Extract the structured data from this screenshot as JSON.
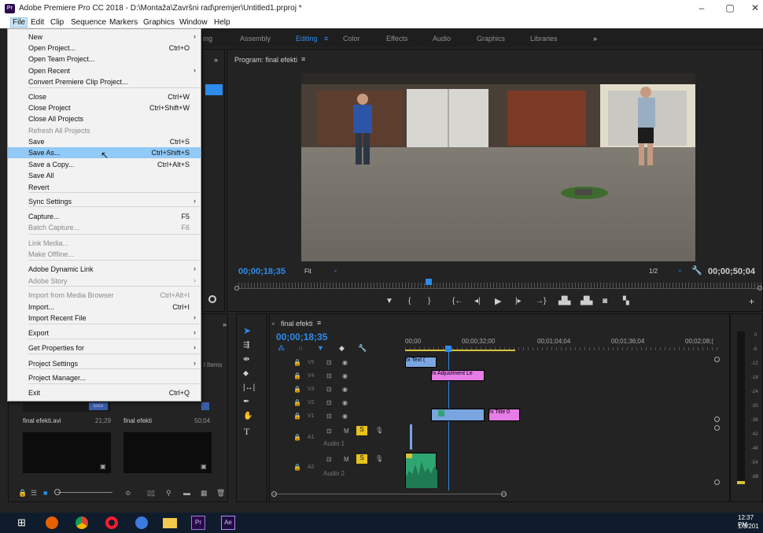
{
  "window": {
    "title": "Adobe Premiere Pro CC 2018 - D:\\Montaža\\Završni rad\\premjer\\Untitled1.prproj *",
    "logo": "Pr",
    "minimize": "–",
    "maximize": "▢",
    "close": "✕"
  },
  "menubar": [
    "File",
    "Edit",
    "Clip",
    "Sequence",
    "Markers",
    "Graphics",
    "Window",
    "Help"
  ],
  "workspaces": [
    "ing",
    "Assembly",
    "Editing",
    "≡",
    "Color",
    "Effects",
    "Audio",
    "Graphics",
    "Libraries",
    "»"
  ],
  "file_menu": [
    {
      "label": "New",
      "shortcut": "",
      "submenu": true,
      "disabled": false
    },
    {
      "label": "Open Project...",
      "shortcut": "Ctrl+O",
      "submenu": false,
      "disabled": false
    },
    {
      "label": "Open Team Project...",
      "shortcut": "",
      "submenu": false,
      "disabled": false
    },
    {
      "label": "Open Recent",
      "shortcut": "",
      "submenu": true,
      "disabled": false
    },
    {
      "label": "Convert Premiere Clip Project...",
      "shortcut": "",
      "submenu": false,
      "disabled": false
    },
    {
      "label": "Close",
      "shortcut": "Ctrl+W",
      "submenu": false,
      "disabled": false
    },
    {
      "label": "Close Project",
      "shortcut": "Ctrl+Shift+W",
      "submenu": false,
      "disabled": false
    },
    {
      "label": "Close All Projects",
      "shortcut": "",
      "submenu": false,
      "disabled": false
    },
    {
      "label": "Refresh All Projects",
      "shortcut": "",
      "submenu": false,
      "disabled": true
    },
    {
      "label": "Save",
      "shortcut": "Ctrl+S",
      "submenu": false,
      "disabled": false
    },
    {
      "label": "Save As...",
      "shortcut": "Ctrl+Shift+S",
      "submenu": false,
      "disabled": false,
      "highlighted": true
    },
    {
      "label": "Save a Copy...",
      "shortcut": "Ctrl+Alt+S",
      "submenu": false,
      "disabled": false
    },
    {
      "label": "Save All",
      "shortcut": "",
      "submenu": false,
      "disabled": false
    },
    {
      "label": "Revert",
      "shortcut": "",
      "submenu": false,
      "disabled": false
    },
    {
      "label": "Sync Settings",
      "shortcut": "",
      "submenu": true,
      "disabled": false
    },
    {
      "label": "Capture...",
      "shortcut": "F5",
      "submenu": false,
      "disabled": false
    },
    {
      "label": "Batch Capture...",
      "shortcut": "F6",
      "submenu": false,
      "disabled": true
    },
    {
      "label": "Link Media...",
      "shortcut": "",
      "submenu": false,
      "disabled": true
    },
    {
      "label": "Make Offline...",
      "shortcut": "",
      "submenu": false,
      "disabled": true
    },
    {
      "label": "Adobe Dynamic Link",
      "shortcut": "",
      "submenu": true,
      "disabled": false
    },
    {
      "label": "Adobe Story",
      "shortcut": "",
      "submenu": true,
      "disabled": true
    },
    {
      "label": "Import from Media Browser",
      "shortcut": "Ctrl+Alt+I",
      "submenu": false,
      "disabled": true
    },
    {
      "label": "Import...",
      "shortcut": "Ctrl+I",
      "submenu": false,
      "disabled": false
    },
    {
      "label": "Import Recent File",
      "shortcut": "",
      "submenu": true,
      "disabled": false
    },
    {
      "label": "Export",
      "shortcut": "",
      "submenu": true,
      "disabled": false
    },
    {
      "label": "Get Properties for",
      "shortcut": "",
      "submenu": true,
      "disabled": false
    },
    {
      "label": "Project Settings",
      "shortcut": "",
      "submenu": true,
      "disabled": false
    },
    {
      "label": "Project Manager...",
      "shortcut": "",
      "submenu": false,
      "disabled": false
    },
    {
      "label": "Exit",
      "shortcut": "Ctrl+Q",
      "submenu": false,
      "disabled": false
    }
  ],
  "program": {
    "title": "Program: final efekti",
    "menu_icon": "≡",
    "timecode_left": "00;00;18;35",
    "fit": "Fit",
    "resolution": "1/2",
    "timecode_right": "00;00;50;04"
  },
  "timeline": {
    "title": "final efekti",
    "menu_icon": "≡",
    "timecode": "00;00;18;35",
    "ruler": [
      "00;00",
      "00;00;32;00",
      "00;01;04;04",
      "00;01;36;04",
      "00;02;08;("
    ],
    "video_tracks": [
      "V5",
      "V4",
      "V3",
      "V2",
      "V1"
    ],
    "audio_tracks": [
      {
        "id": "A1",
        "name": "Audio 1"
      },
      {
        "id": "A2",
        "name": "Audio 2"
      }
    ],
    "clips": {
      "v5": "fx Text (",
      "v4": "fx Adjustment Le",
      "v1_title": "fx Title 0"
    }
  },
  "project_panel": {
    "items_label": "l Items",
    "clip1_name": "final efekti.avi",
    "clip1_dur": "21;29",
    "clip2_name": "final efekti",
    "clip2_dur": "50;04"
  },
  "meters": [
    "0",
    "-6",
    "-12",
    "-18",
    "-24",
    "-30",
    "-36",
    "-42",
    "-48",
    "-54",
    "-dB"
  ],
  "taskbar": {
    "time": "12:37 PM",
    "date": "1/3/201",
    "apps": [
      "Pr",
      "Ae"
    ]
  },
  "colors": {
    "accent_blue": "#2d8ceb",
    "menu_highlight": "#91c9f7",
    "clip_pink": "#e67ce6",
    "clip_blue": "#7aa5e0",
    "audio_green": "#2fa572"
  }
}
